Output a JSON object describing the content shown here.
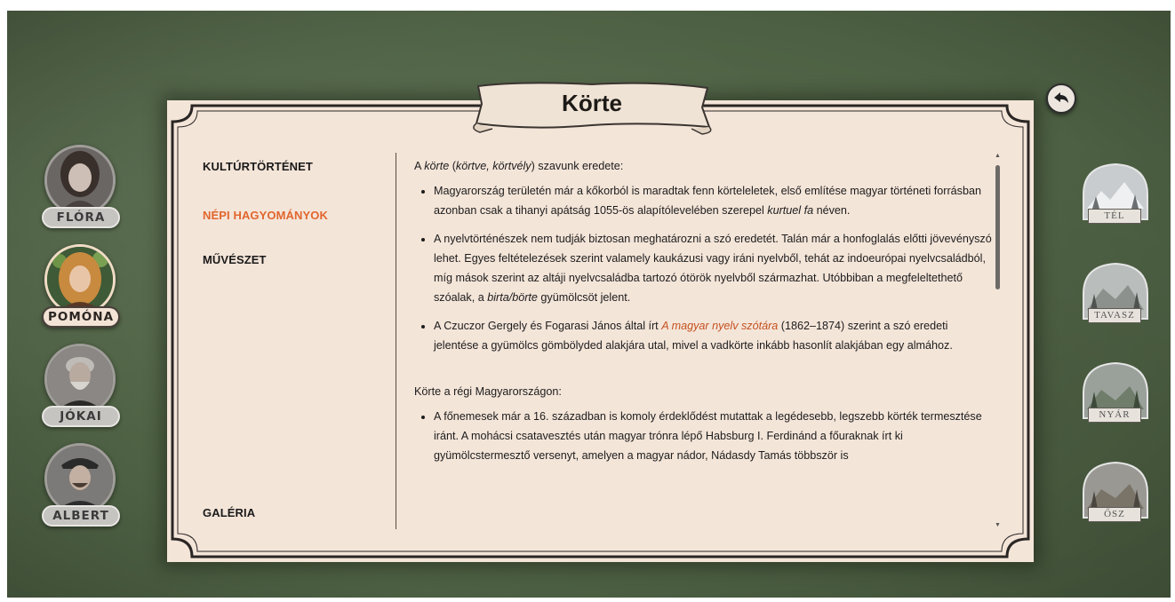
{
  "title": "Körte",
  "menu": {
    "items": [
      {
        "label": "KULTÚRTÖRTÉNET"
      },
      {
        "label": "NÉPI HAGYOMÁNYOK"
      },
      {
        "label": "MŰVÉSZET"
      },
      {
        "label": "GALÉRIA"
      }
    ],
    "active_color": "#e1662e"
  },
  "people": [
    {
      "name": "FLÓRA"
    },
    {
      "name": "POMÓNA"
    },
    {
      "name": "JÓKAI"
    },
    {
      "name": "ALBERT"
    }
  ],
  "seasons": [
    {
      "name": "TÉL"
    },
    {
      "name": "TAVASZ"
    },
    {
      "name": "NYÁR"
    },
    {
      "name": "ŐSZ"
    }
  ],
  "content": {
    "s1_intro_a": "A ",
    "s1_intro_b": "körte",
    "s1_intro_c": " (",
    "s1_intro_d": "körtve, körtvély",
    "s1_intro_e": ") szavunk eredete:",
    "b1_a": "Magyarország területén már a kőkorból is maradtak fenn körteleletek, első említése magyar történeti forrásban azonban csak a tihanyi apátság 1055-ös alapítólevelében szerepel ",
    "b1_b": "kurtuel fa",
    "b1_c": " néven.",
    "b2_a": "A nyelvtörténészek nem tudják biztosan meghatározni a szó eredetét. Talán már a honfoglalás előtti jövevényszó lehet. Egyes feltételezések szerint valamely kaukázusi vagy iráni nyelvből, tehát az indoeurópai nyelvcsaládból, míg mások szerint az altáji nyelvcsaládba tartozó ótörök nyelvből származhat. Utóbbiban a megfeleltethető szóalak, a ",
    "b2_b": "birta/börte",
    "b2_c": " gyümölcsöt jelent.",
    "b3_a": "A Czuczor Gergely és Fogarasi János által írt ",
    "b3_link": "A magyar nyelv szótára",
    "b3_b": " (1862–1874) szerint a szó eredeti jelentése a gyümölcs gömbölyded alakjára utal, mivel a vadkörte inkább hasonlít alakjában egy almához.",
    "s2_intro": "Körte a régi Magyarországon:",
    "b4": "A főnemesek már a 16. században is komoly érdeklődést mutattak a legédesebb, legszebb körték termesztése iránt. A mohácsi csatavesztés után magyar trónra lépő Habsburg I. Ferdinánd a főuraknak írt ki gyümölcstermesztő versenyt, amelyen a magyar nádor, Nádasdy Tamás többször is"
  },
  "icons": {
    "back": "back-arrow-icon",
    "scroll_up": "scroll-up-icon",
    "scroll_down": "scroll-down-icon"
  }
}
